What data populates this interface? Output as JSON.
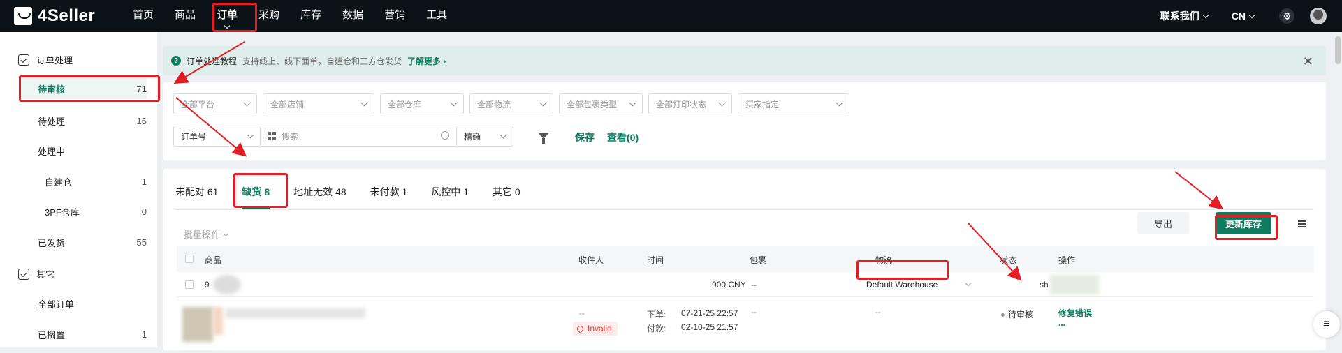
{
  "header": {
    "logo": "4Seller",
    "nav": [
      "首页",
      "商品",
      "订单",
      "采购",
      "库存",
      "数据",
      "营销",
      "工具"
    ],
    "active_nav": "订单",
    "contact": "联系我们",
    "lang": "CN"
  },
  "sidebar": {
    "group1": "订单处理",
    "items": [
      {
        "label": "待审核",
        "count": "71"
      },
      {
        "label": "待处理",
        "count": "16"
      },
      {
        "label": "处理中",
        "count": ""
      },
      {
        "label": "自建仓",
        "count": "1"
      },
      {
        "label": "3PF仓库",
        "count": "0"
      },
      {
        "label": "已发货",
        "count": "55"
      }
    ],
    "group2": "其它",
    "items2": [
      {
        "label": "全部订单",
        "count": ""
      },
      {
        "label": "已搁置",
        "count": "1"
      }
    ]
  },
  "notice": {
    "title": "订单处理教程",
    "desc": "支持线上、线下面单，自建仓和三方仓发货",
    "link": "了解更多"
  },
  "filters": {
    "selects": [
      "全部平台",
      "全部店铺",
      "全部仓库",
      "全部物流",
      "全部包裹类型",
      "全部打印状态",
      "买家指定"
    ],
    "order_field": "订单号",
    "search_placeholder": "搜索",
    "match_mode": "精确",
    "save": "保存",
    "view": "查看(0)"
  },
  "tabs": [
    "未配对 61",
    "缺货 8",
    "地址无效 48",
    "未付款 1",
    "风控中 1",
    "其它 0"
  ],
  "active_tab": "缺货 8",
  "toolbar": {
    "batch": "批量操作",
    "export": "导出",
    "update_stock": "更新库存"
  },
  "table": {
    "headers": [
      "商品",
      "收件人",
      "时间",
      "包裹",
      "物流",
      "状态",
      "操作"
    ],
    "row1": {
      "id": "9",
      "amount": "900 CNY",
      "package": "--",
      "warehouse": "Default Warehouse",
      "ship": "sh"
    },
    "row2": {
      "recipient": "--",
      "invalid": "Invalid",
      "order_time_label": "下单:",
      "order_time": "07-21-25 22:57",
      "pay_time_label": "付款:",
      "pay_time": "02-10-25 21:57",
      "package": "--",
      "logistics": "--",
      "status": "待审核",
      "action": "修复错误",
      "more": "..."
    }
  },
  "colors": {
    "accent": "#0e7a5f",
    "annotation": "#e41e25",
    "topbar": "#0b1218"
  }
}
